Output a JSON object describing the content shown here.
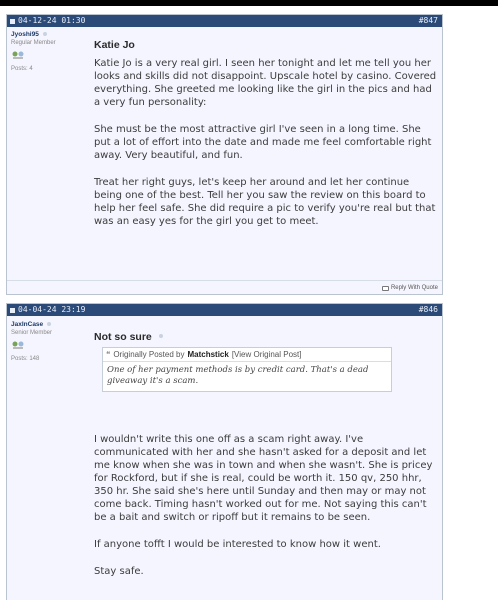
{
  "post1": {
    "date": "04-12-24 01:30",
    "number": "#847",
    "username": "Jyoshi95",
    "usertitle": "Regular Member",
    "postcount": "Posts: 4",
    "title": "Katie Jo",
    "paragraphs": [
      "Katie Jo is a very real girl. I seen her tonight and let me tell you her looks and skills did not disappoint. Upscale hotel by casino. Covered everything. She greeted me looking like the girl in the pics and had a very fun personality:",
      "She must be the most attractive girl I've seen in a long time. She put a lot of effort into the date and made me feel comfortable right away. Very beautiful, and fun.",
      "Treat her right guys, let's keep her around and let her continue being one of the best. Tell her you saw the review on this board to help her feel safe. She did require a pic to verify you're real but that was an easy yes for the girl you get to meet."
    ],
    "reply_label": "Reply With Quote"
  },
  "post2": {
    "date": "04-04-24 23:19",
    "number": "#846",
    "username": "JaxInCase",
    "usertitle": "Senior Member",
    "postcount": "Posts: 148",
    "title": "Not so sure",
    "quote": {
      "prefix": "Originally Posted by",
      "author": "Matchstick",
      "view_link": "[View Original Post]",
      "text": "One of her payment methods is by credit card. That's a dead giveaway it's a scam."
    },
    "paragraphs": [
      "I wouldn't write this one off as a scam right away. I've communicated with her and she hasn't asked for a deposit and let me know when she was in town and when she wasn't. She is pricey for Rockford, but if she is real, could be worth it. 150 qv, 250 hhr, 350 hr. She said she's here until Sunday and then may or may not come back. Timing hasn't worked out for me. Not saying this can't be a bait and switch or ripoff but it remains to be seen.",
      "If anyone tofft I would be interested to know how it went.",
      "Stay safe."
    ]
  },
  "colors": {
    "header_bg": "#2b4a78",
    "post_bg": "#f5f5ff",
    "username": "#1d3a66"
  }
}
